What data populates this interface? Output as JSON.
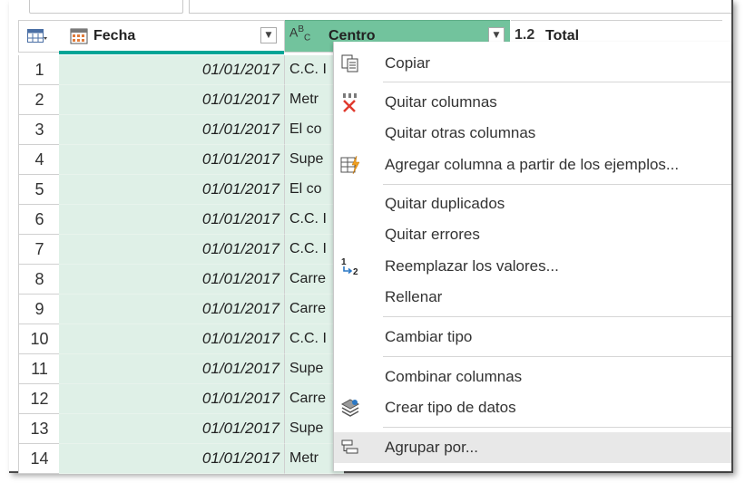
{
  "grid": {
    "columns": [
      {
        "name": "Fecha",
        "type_icon": "calendar-icon"
      },
      {
        "name": "Centro",
        "type_icon": "ABC"
      },
      {
        "name": "Total",
        "type_icon": "1.2"
      }
    ],
    "rows": [
      {
        "n": "1",
        "fecha": "01/01/2017",
        "centro": "C.C. I"
      },
      {
        "n": "2",
        "fecha": "01/01/2017",
        "centro": "Metr"
      },
      {
        "n": "3",
        "fecha": "01/01/2017",
        "centro": "El co"
      },
      {
        "n": "4",
        "fecha": "01/01/2017",
        "centro": "Supe"
      },
      {
        "n": "5",
        "fecha": "01/01/2017",
        "centro": "El co"
      },
      {
        "n": "6",
        "fecha": "01/01/2017",
        "centro": "C.C. I"
      },
      {
        "n": "7",
        "fecha": "01/01/2017",
        "centro": "C.C. I"
      },
      {
        "n": "8",
        "fecha": "01/01/2017",
        "centro": "Carre"
      },
      {
        "n": "9",
        "fecha": "01/01/2017",
        "centro": "Carre"
      },
      {
        "n": "10",
        "fecha": "01/01/2017",
        "centro": "C.C. I"
      },
      {
        "n": "11",
        "fecha": "01/01/2017",
        "centro": "Supe"
      },
      {
        "n": "12",
        "fecha": "01/01/2017",
        "centro": "Carre"
      },
      {
        "n": "13",
        "fecha": "01/01/2017",
        "centro": "Supe"
      },
      {
        "n": "14",
        "fecha": "01/01/2017",
        "centro": "Metr"
      }
    ]
  },
  "menu": {
    "copiar": "Copiar",
    "quitar_columnas": "Quitar columnas",
    "quitar_otras": "Quitar otras columnas",
    "agregar_ejemplos": "Agregar columna a partir de los ejemplos...",
    "quitar_duplicados": "Quitar duplicados",
    "quitar_errores": "Quitar errores",
    "reemplazar": "Reemplazar los valores...",
    "rellenar": "Rellenar",
    "cambiar_tipo": "Cambiar tipo",
    "combinar": "Combinar columnas",
    "crear_tipo": "Crear tipo de datos",
    "agrupar": "Agrupar por..."
  },
  "colors": {
    "selected_header": "#72c39d",
    "selected_cells": "#dff0e7",
    "accent_bar": "#00a596",
    "remove_icon_red": "#e03a2e"
  }
}
